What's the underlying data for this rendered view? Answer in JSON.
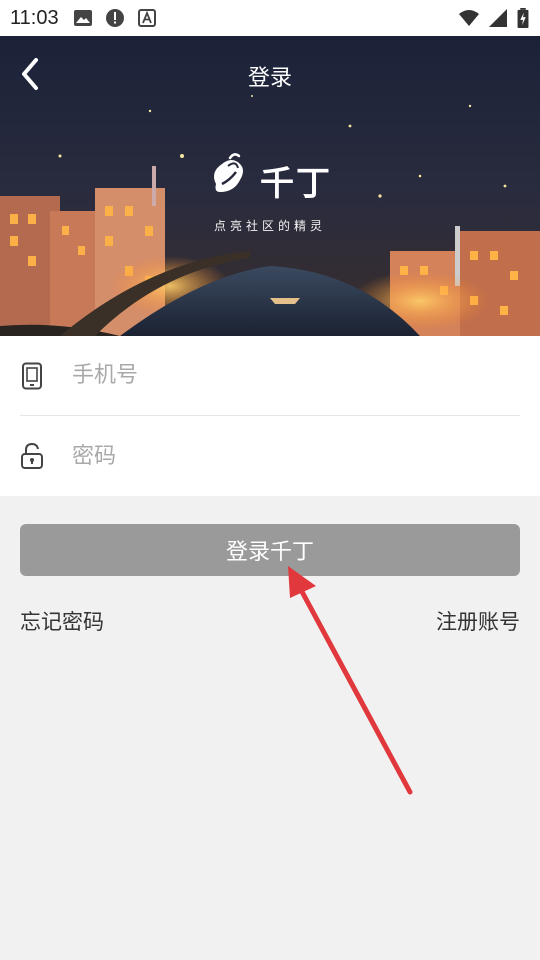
{
  "status_bar": {
    "time": "11:03",
    "left_icons": [
      "image-icon",
      "alert-icon",
      "a-icon"
    ],
    "right_icons": [
      "wifi-icon",
      "signal-icon",
      "battery-charging-icon"
    ]
  },
  "nav": {
    "title": "登录",
    "back_icon": "chevron-left-icon"
  },
  "banner": {
    "brand": "千丁",
    "slogan": "点亮社区的精灵"
  },
  "form": {
    "phone_placeholder": "手机号",
    "password_placeholder": "密码",
    "phone_icon": "phone-icon",
    "password_icon": "unlock-icon"
  },
  "actions": {
    "login_label": "登录千丁",
    "forgot_label": "忘记密码",
    "register_label": "注册账号"
  },
  "colors": {
    "button_bg": "#9a9a9a",
    "arrow": "#e0383c",
    "page_bg": "#f1f1f1"
  }
}
